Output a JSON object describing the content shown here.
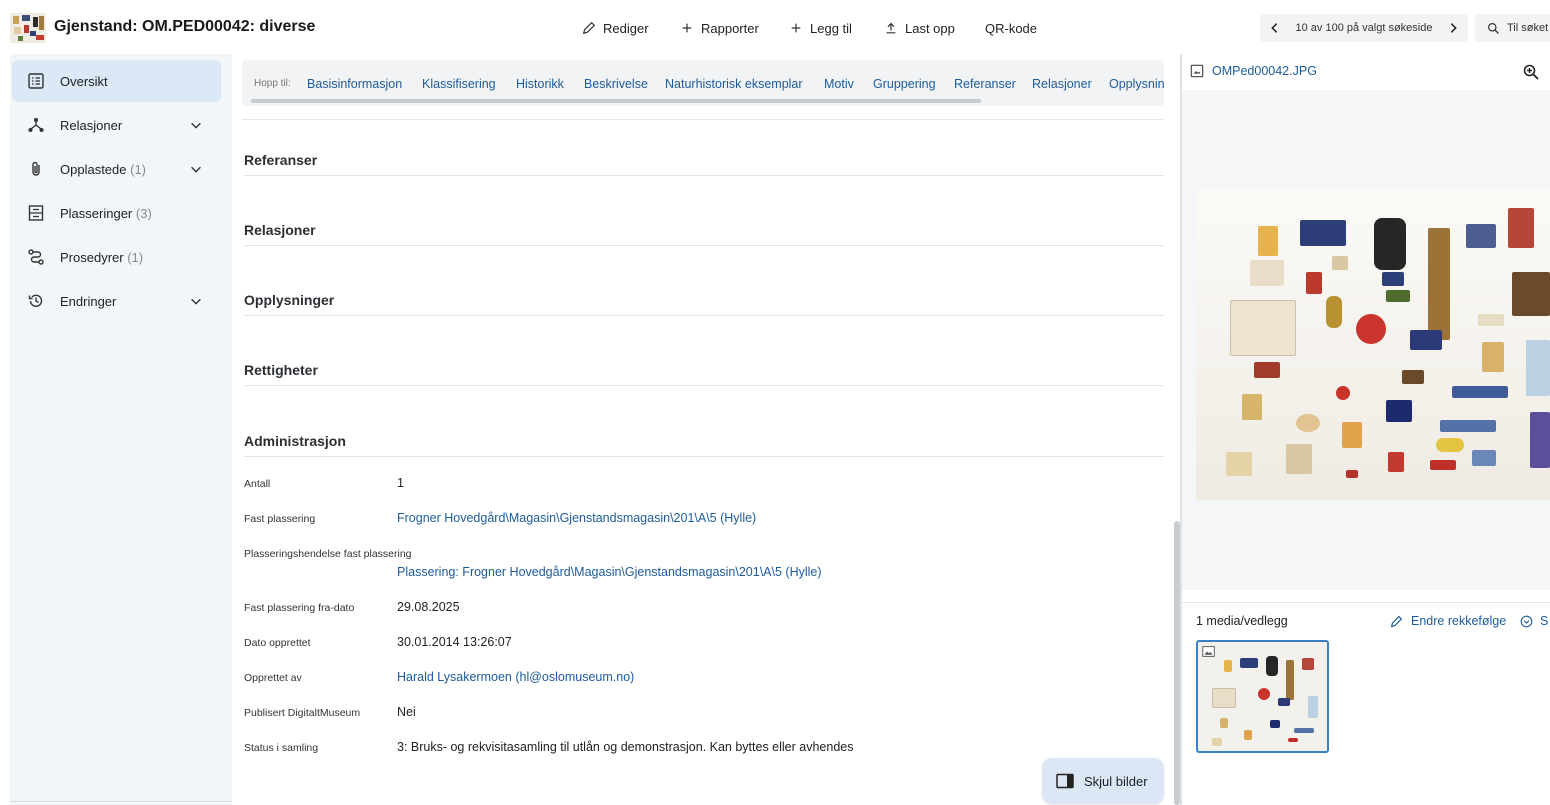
{
  "header": {
    "title": "Gjenstand: OM.PED00042: diverse",
    "actions": {
      "edit": "Rediger",
      "reports": "Rapporter",
      "add": "Legg til",
      "upload": "Last opp",
      "qr": "QR-kode"
    },
    "pager_text": "10 av 100 på valgt søkeside",
    "back_to_search": "Til søket"
  },
  "sidebar": {
    "items": [
      {
        "label": "Oversikt",
        "count": "",
        "icon": "list-icon",
        "expandable": false,
        "active": true
      },
      {
        "label": "Relasjoner",
        "count": "",
        "icon": "relations-icon",
        "expandable": true,
        "active": false
      },
      {
        "label": "Opplastede",
        "count": "(1)",
        "icon": "paperclip-icon",
        "expandable": true,
        "active": false
      },
      {
        "label": "Plasseringer",
        "count": "(3)",
        "icon": "shelf-icon",
        "expandable": false,
        "active": false
      },
      {
        "label": "Prosedyrer",
        "count": "(1)",
        "icon": "route-icon",
        "expandable": false,
        "active": false
      },
      {
        "label": "Endringer",
        "count": "",
        "icon": "history-icon",
        "expandable": true,
        "active": false
      }
    ]
  },
  "jumpbar": {
    "label": "Hopp til:",
    "links": [
      "Basisinformasjon",
      "Klassifisering",
      "Historikk",
      "Beskrivelse",
      "Naturhistorisk eksemplar",
      "Motiv",
      "Gruppering",
      "Referanser",
      "Relasjoner",
      "Opplysninger"
    ]
  },
  "sections": {
    "referanser": "Referanser",
    "relasjoner": "Relasjoner",
    "opplysninger": "Opplysninger",
    "rettigheter": "Rettigheter",
    "administrasjon": "Administrasjon"
  },
  "admin_fields": {
    "antall": {
      "label": "Antall",
      "value": "1"
    },
    "fast_plassering": {
      "label": "Fast plassering",
      "value": "Frogner Hovedgård\\Magasin\\Gjenstandsmagasin\\201\\A\\5 (Hylle)"
    },
    "plasseringshendelse": {
      "label": "Plasseringshendelse fast plassering",
      "value": "Plassering: Frogner Hovedgård\\Magasin\\Gjenstandsmagasin\\201\\A\\5 (Hylle)"
    },
    "fra_dato": {
      "label": "Fast plassering fra-dato",
      "value": "29.08.2025"
    },
    "dato_opprettet": {
      "label": "Dato opprettet",
      "value": "30.01.2014 13:26:07"
    },
    "opprettet_av": {
      "label": "Opprettet av",
      "value": "Harald Lysakermoen (hl@oslomuseum.no)"
    },
    "publisert": {
      "label": "Publisert DigitaltMuseum",
      "value": "Nei"
    },
    "status": {
      "label": "Status i samling",
      "value": "3: Bruks- og rekvisitasamling til utlån og demonstrasjon. Kan byttes eller avhendes"
    }
  },
  "hide_images_label": "Skjul bilder",
  "media": {
    "filename": "OMPed00042.JPG",
    "count_label": "1 media/vedlegg",
    "reorder_label": "Endre rekkefølge",
    "show_more_label": "S"
  },
  "colors": {
    "link": "#1d5c9b",
    "active_nav_bg": "#dbe9f6",
    "sidebar_bg": "#f3f6f9",
    "thumb_border": "#3a7fc4"
  }
}
